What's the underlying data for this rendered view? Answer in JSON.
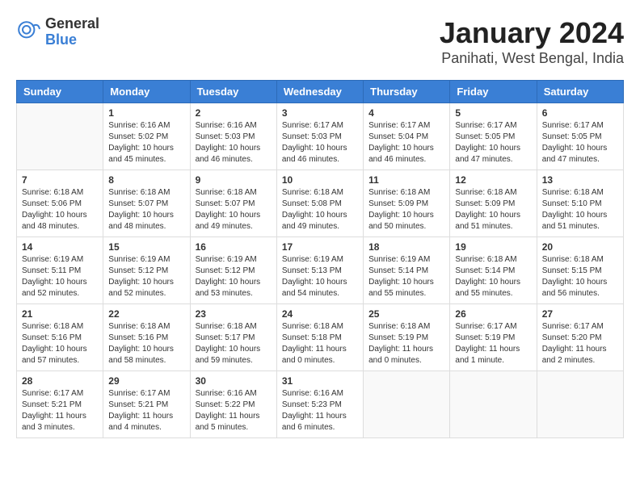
{
  "header": {
    "logo_general": "General",
    "logo_blue": "Blue",
    "title": "January 2024",
    "subtitle": "Panihati, West Bengal, India"
  },
  "days_of_week": [
    "Sunday",
    "Monday",
    "Tuesday",
    "Wednesday",
    "Thursday",
    "Friday",
    "Saturday"
  ],
  "weeks": [
    [
      {
        "day": "",
        "info": ""
      },
      {
        "day": "1",
        "info": "Sunrise: 6:16 AM\nSunset: 5:02 PM\nDaylight: 10 hours\nand 45 minutes."
      },
      {
        "day": "2",
        "info": "Sunrise: 6:16 AM\nSunset: 5:03 PM\nDaylight: 10 hours\nand 46 minutes."
      },
      {
        "day": "3",
        "info": "Sunrise: 6:17 AM\nSunset: 5:03 PM\nDaylight: 10 hours\nand 46 minutes."
      },
      {
        "day": "4",
        "info": "Sunrise: 6:17 AM\nSunset: 5:04 PM\nDaylight: 10 hours\nand 46 minutes."
      },
      {
        "day": "5",
        "info": "Sunrise: 6:17 AM\nSunset: 5:05 PM\nDaylight: 10 hours\nand 47 minutes."
      },
      {
        "day": "6",
        "info": "Sunrise: 6:17 AM\nSunset: 5:05 PM\nDaylight: 10 hours\nand 47 minutes."
      }
    ],
    [
      {
        "day": "7",
        "info": "Sunrise: 6:18 AM\nSunset: 5:06 PM\nDaylight: 10 hours\nand 48 minutes."
      },
      {
        "day": "8",
        "info": "Sunrise: 6:18 AM\nSunset: 5:07 PM\nDaylight: 10 hours\nand 48 minutes."
      },
      {
        "day": "9",
        "info": "Sunrise: 6:18 AM\nSunset: 5:07 PM\nDaylight: 10 hours\nand 49 minutes."
      },
      {
        "day": "10",
        "info": "Sunrise: 6:18 AM\nSunset: 5:08 PM\nDaylight: 10 hours\nand 49 minutes."
      },
      {
        "day": "11",
        "info": "Sunrise: 6:18 AM\nSunset: 5:09 PM\nDaylight: 10 hours\nand 50 minutes."
      },
      {
        "day": "12",
        "info": "Sunrise: 6:18 AM\nSunset: 5:09 PM\nDaylight: 10 hours\nand 51 minutes."
      },
      {
        "day": "13",
        "info": "Sunrise: 6:18 AM\nSunset: 5:10 PM\nDaylight: 10 hours\nand 51 minutes."
      }
    ],
    [
      {
        "day": "14",
        "info": "Sunrise: 6:19 AM\nSunset: 5:11 PM\nDaylight: 10 hours\nand 52 minutes."
      },
      {
        "day": "15",
        "info": "Sunrise: 6:19 AM\nSunset: 5:12 PM\nDaylight: 10 hours\nand 52 minutes."
      },
      {
        "day": "16",
        "info": "Sunrise: 6:19 AM\nSunset: 5:12 PM\nDaylight: 10 hours\nand 53 minutes."
      },
      {
        "day": "17",
        "info": "Sunrise: 6:19 AM\nSunset: 5:13 PM\nDaylight: 10 hours\nand 54 minutes."
      },
      {
        "day": "18",
        "info": "Sunrise: 6:19 AM\nSunset: 5:14 PM\nDaylight: 10 hours\nand 55 minutes."
      },
      {
        "day": "19",
        "info": "Sunrise: 6:18 AM\nSunset: 5:14 PM\nDaylight: 10 hours\nand 55 minutes."
      },
      {
        "day": "20",
        "info": "Sunrise: 6:18 AM\nSunset: 5:15 PM\nDaylight: 10 hours\nand 56 minutes."
      }
    ],
    [
      {
        "day": "21",
        "info": "Sunrise: 6:18 AM\nSunset: 5:16 PM\nDaylight: 10 hours\nand 57 minutes."
      },
      {
        "day": "22",
        "info": "Sunrise: 6:18 AM\nSunset: 5:16 PM\nDaylight: 10 hours\nand 58 minutes."
      },
      {
        "day": "23",
        "info": "Sunrise: 6:18 AM\nSunset: 5:17 PM\nDaylight: 10 hours\nand 59 minutes."
      },
      {
        "day": "24",
        "info": "Sunrise: 6:18 AM\nSunset: 5:18 PM\nDaylight: 11 hours\nand 0 minutes."
      },
      {
        "day": "25",
        "info": "Sunrise: 6:18 AM\nSunset: 5:19 PM\nDaylight: 11 hours\nand 0 minutes."
      },
      {
        "day": "26",
        "info": "Sunrise: 6:17 AM\nSunset: 5:19 PM\nDaylight: 11 hours\nand 1 minute."
      },
      {
        "day": "27",
        "info": "Sunrise: 6:17 AM\nSunset: 5:20 PM\nDaylight: 11 hours\nand 2 minutes."
      }
    ],
    [
      {
        "day": "28",
        "info": "Sunrise: 6:17 AM\nSunset: 5:21 PM\nDaylight: 11 hours\nand 3 minutes."
      },
      {
        "day": "29",
        "info": "Sunrise: 6:17 AM\nSunset: 5:21 PM\nDaylight: 11 hours\nand 4 minutes."
      },
      {
        "day": "30",
        "info": "Sunrise: 6:16 AM\nSunset: 5:22 PM\nDaylight: 11 hours\nand 5 minutes."
      },
      {
        "day": "31",
        "info": "Sunrise: 6:16 AM\nSunset: 5:23 PM\nDaylight: 11 hours\nand 6 minutes."
      },
      {
        "day": "",
        "info": ""
      },
      {
        "day": "",
        "info": ""
      },
      {
        "day": "",
        "info": ""
      }
    ]
  ]
}
